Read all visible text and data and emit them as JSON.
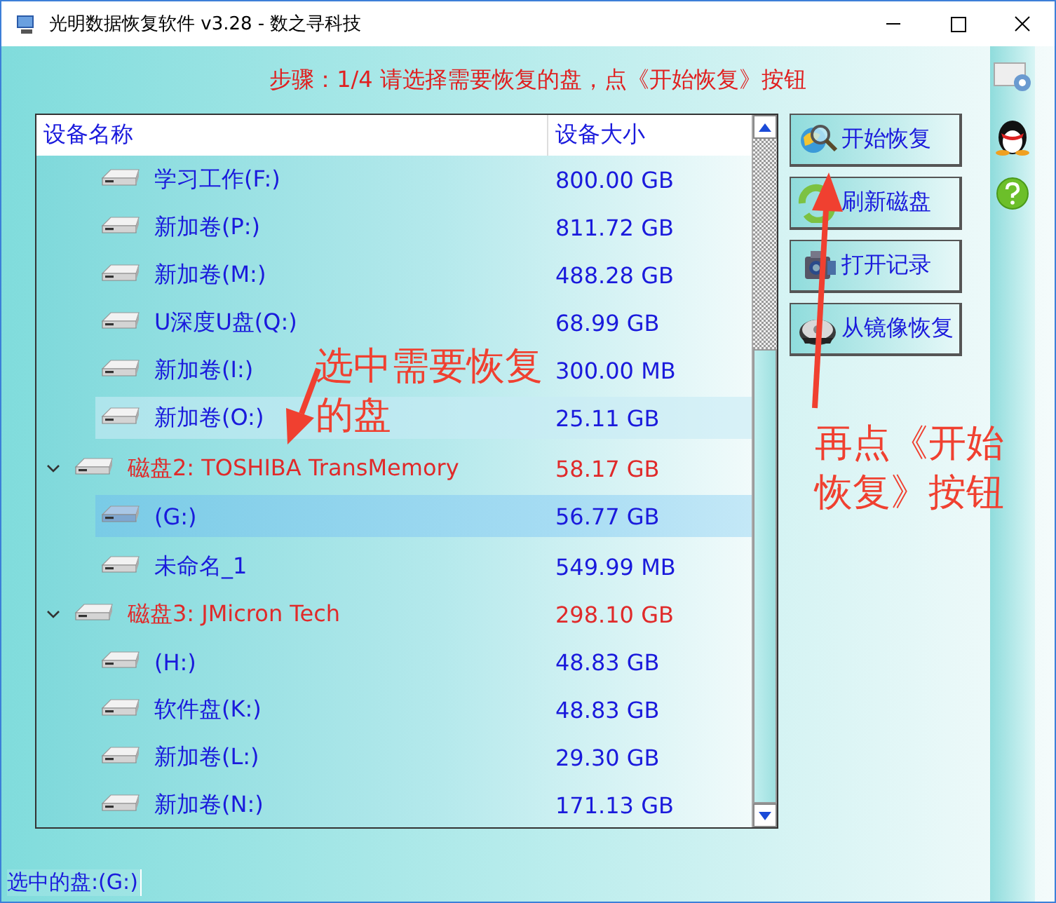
{
  "window": {
    "title": "光明数据恢复软件 v3.28 - 数之寻科技"
  },
  "step_message": "步骤：1/4 请选择需要恢复的盘，点《开始恢复》按钮",
  "device_list": {
    "columns": [
      "设备名称",
      "设备大小"
    ],
    "rows": [
      {
        "kind": "volume",
        "name": "学习工作(F:)",
        "size": "800.00 GB",
        "selected": false,
        "hovered": false
      },
      {
        "kind": "volume",
        "name": "新加卷(P:)",
        "size": "811.72 GB",
        "selected": false,
        "hovered": false
      },
      {
        "kind": "volume",
        "name": "新加卷(M:)",
        "size": "488.28 GB",
        "selected": false,
        "hovered": false
      },
      {
        "kind": "volume",
        "name": "U深度U盘(Q:)",
        "size": "68.99 GB",
        "selected": false,
        "hovered": false
      },
      {
        "kind": "volume",
        "name": "新加卷(I:)",
        "size": "300.00 MB",
        "selected": false,
        "hovered": false
      },
      {
        "kind": "volume",
        "name": "新加卷(O:)",
        "size": "25.11 GB",
        "selected": false,
        "hovered": true
      },
      {
        "kind": "disk",
        "name": "磁盘2: TOSHIBA  TransMemory",
        "size": "58.17 GB",
        "expanded": true,
        "children": [
          {
            "kind": "volume",
            "name": "(G:)",
            "size": "56.77 GB",
            "selected": true,
            "hovered": false
          },
          {
            "kind": "volume",
            "name": "未命名_1",
            "size": "549.99 MB",
            "selected": false,
            "hovered": false
          }
        ]
      },
      {
        "kind": "disk",
        "name": "磁盘3: JMicron  Tech",
        "size": "298.10 GB",
        "expanded": true,
        "children": [
          {
            "kind": "volume",
            "name": "(H:)",
            "size": "48.83 GB",
            "selected": false,
            "hovered": false
          },
          {
            "kind": "volume",
            "name": "软件盘(K:)",
            "size": "48.83 GB",
            "selected": false,
            "hovered": false
          },
          {
            "kind": "volume",
            "name": "新加卷(L:)",
            "size": "29.30 GB",
            "selected": false,
            "hovered": false
          },
          {
            "kind": "volume",
            "name": "新加卷(N:)",
            "size": "171.13 GB",
            "selected": false,
            "hovered": false
          }
        ]
      }
    ]
  },
  "buttons": [
    {
      "kind": "scan",
      "label": "开始恢复"
    },
    {
      "kind": "refresh",
      "label": "刷新磁盘"
    },
    {
      "kind": "log",
      "label": "打开记录"
    },
    {
      "kind": "image",
      "label": "从镜像恢复"
    }
  ],
  "status_bar": "选中的盘:(G:)",
  "annotations": [
    {
      "kind": "left",
      "text": "选中需要恢复的盘"
    },
    {
      "kind": "right",
      "text": "再点《开始恢复》按钮"
    }
  ]
}
